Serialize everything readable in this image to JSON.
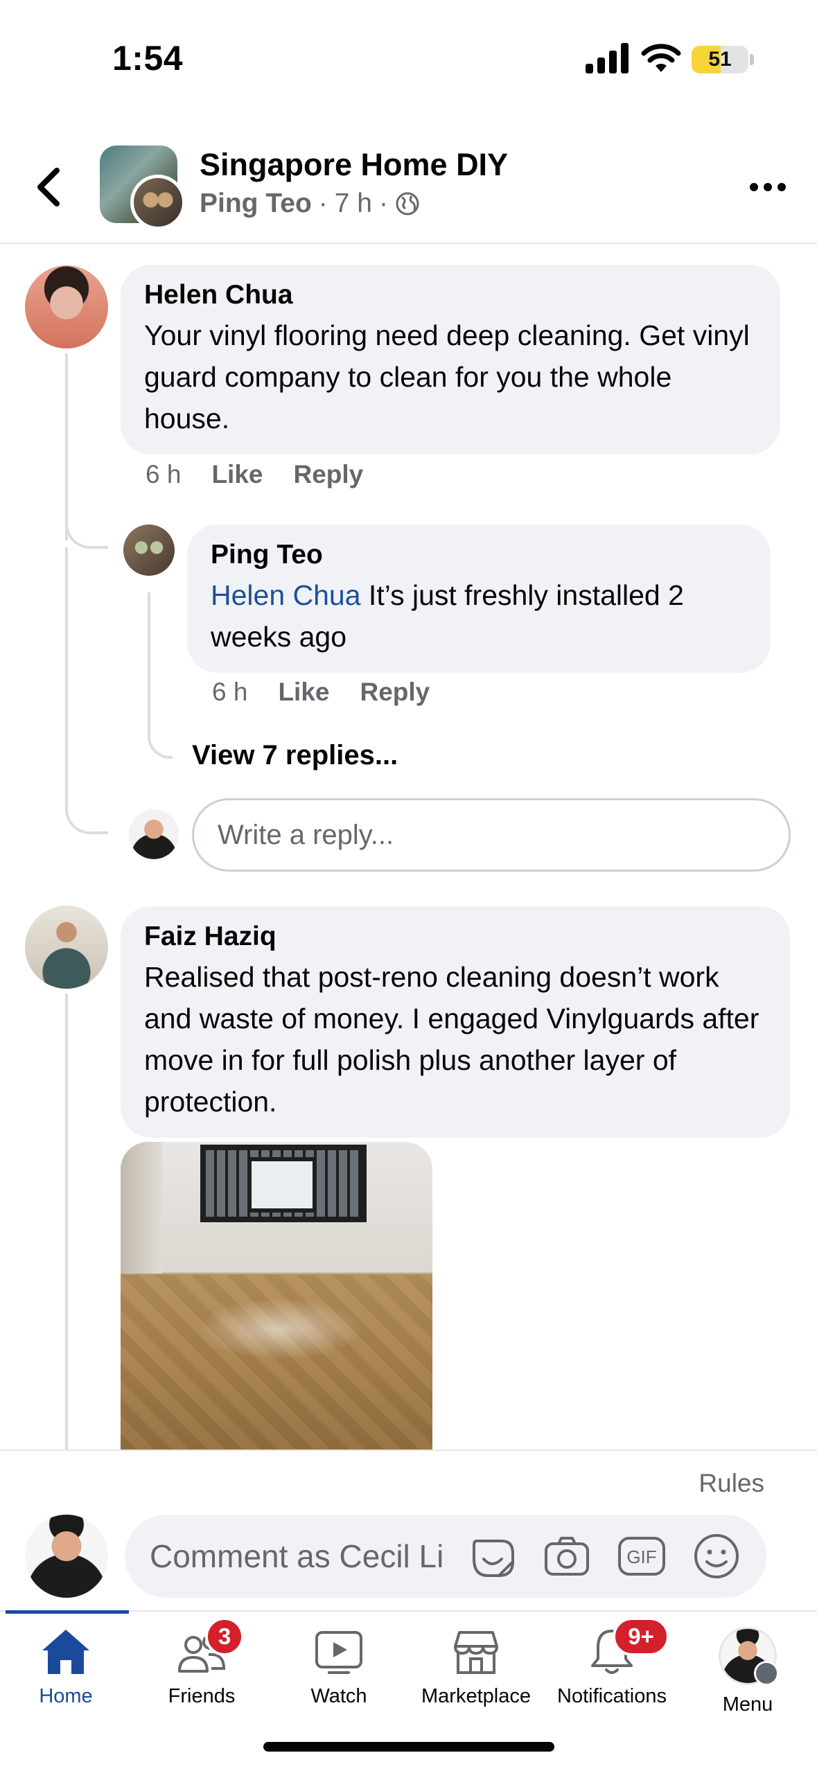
{
  "status_bar": {
    "time": "1:54",
    "battery": "51",
    "battery_level": 0.51
  },
  "header": {
    "group_name": "Singapore Home DIY",
    "poster": "Ping Teo",
    "time_ago": "7 h",
    "separator": "·",
    "icons": {
      "back": "chevron-left-icon",
      "privacy": "globe-icon",
      "more": "ellipsis-icon"
    }
  },
  "comments": [
    {
      "author": "Helen Chua",
      "text": "Your vinyl flooring need deep cleaning. Get vinyl guard company to clean for you the whole house.",
      "time": "6 h",
      "like_label": "Like",
      "reply_label": "Reply",
      "replies": [
        {
          "author": "Ping Teo",
          "mention": "Helen Chua",
          "text": " It’s just freshly installed 2 weeks ago",
          "time": "6 h",
          "like_label": "Like",
          "reply_label": "Reply"
        }
      ],
      "view_replies": "View 7 replies...",
      "reply_placeholder": "Write a reply..."
    },
    {
      "author": "Faiz Haziq",
      "text": "Realised that post-reno cleaning doesn’t work and waste of money. I engaged Vinylguards after move in for full polish plus another layer of protection."
    }
  ],
  "composer": {
    "rules": "Rules",
    "placeholder": "Comment as Cecil Li",
    "icons": [
      "sticker-icon",
      "camera-icon",
      "gif-icon",
      "emoji-icon"
    ]
  },
  "tabs": [
    {
      "label": "Home",
      "icon": "home-icon",
      "active": true
    },
    {
      "label": "Friends",
      "icon": "friends-icon",
      "badge": "3"
    },
    {
      "label": "Watch",
      "icon": "watch-icon"
    },
    {
      "label": "Marketplace",
      "icon": "marketplace-icon"
    },
    {
      "label": "Notifications",
      "icon": "bell-icon",
      "badge": "9+"
    },
    {
      "label": "Menu",
      "icon": "menu-avatar"
    }
  ],
  "colors": {
    "accent": "#1b4a9c",
    "badge": "#d3202b",
    "bubble": "#f0f2f5",
    "secondary_text": "#65676b",
    "battery": "#f6d43a"
  }
}
